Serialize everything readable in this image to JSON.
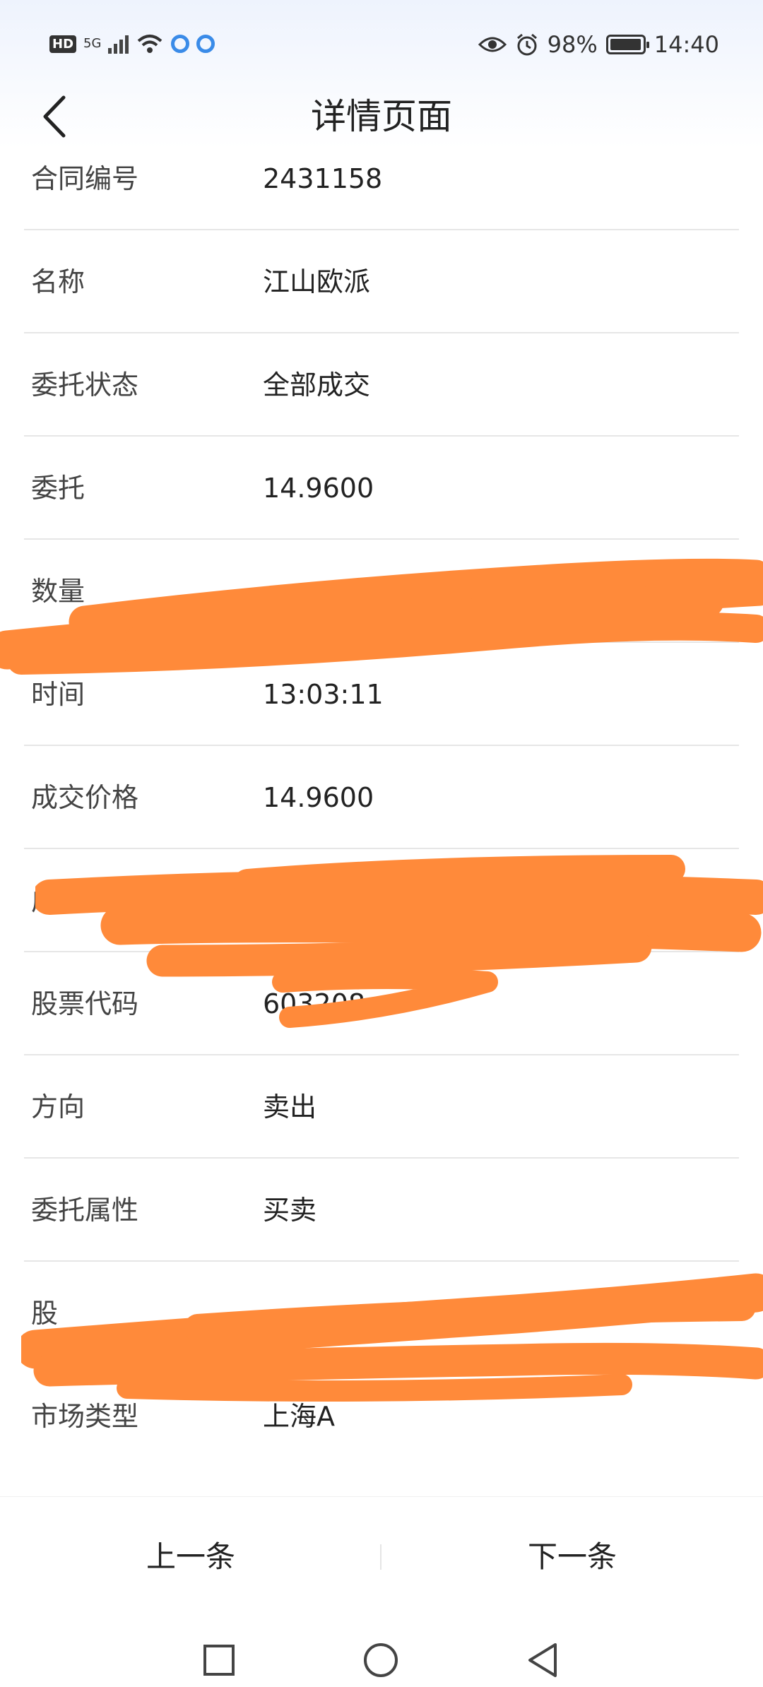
{
  "statusbar": {
    "hd": "HD",
    "network": "5G",
    "battery_percent": "98%",
    "time": "14:40",
    "battery_level": 0.98
  },
  "header": {
    "title": "详情页面"
  },
  "rows": [
    {
      "label": "合同编号",
      "value": "2431158"
    },
    {
      "label": "名称",
      "value": "江山欧派"
    },
    {
      "label": "委托状态",
      "value": "全部成交"
    },
    {
      "label": "委托",
      "value": "14.9600"
    },
    {
      "label": "数量",
      "value": ""
    },
    {
      "label": "时间",
      "value": "13:03:11"
    },
    {
      "label": "成交价格",
      "value": "14.9600"
    },
    {
      "label": "成交数量",
      "value": ""
    },
    {
      "label": "股票代码",
      "value": "603208"
    },
    {
      "label": "方向",
      "value": "卖出"
    },
    {
      "label": "委托属性",
      "value": "买卖"
    },
    {
      "label": "股",
      "value": ""
    },
    {
      "label": "市场类型",
      "value": "上海A"
    }
  ],
  "footer": {
    "prev": "上一条",
    "next": "下一条"
  },
  "colors": {
    "scribble": "#ff8a3a",
    "accent": "#3a8be8"
  },
  "icons": [
    "back-arrow-icon",
    "eye-icon",
    "alarm-icon",
    "battery-icon",
    "wifi-icon",
    "signal-icon",
    "recent-apps-icon",
    "home-icon",
    "nav-back-icon"
  ]
}
